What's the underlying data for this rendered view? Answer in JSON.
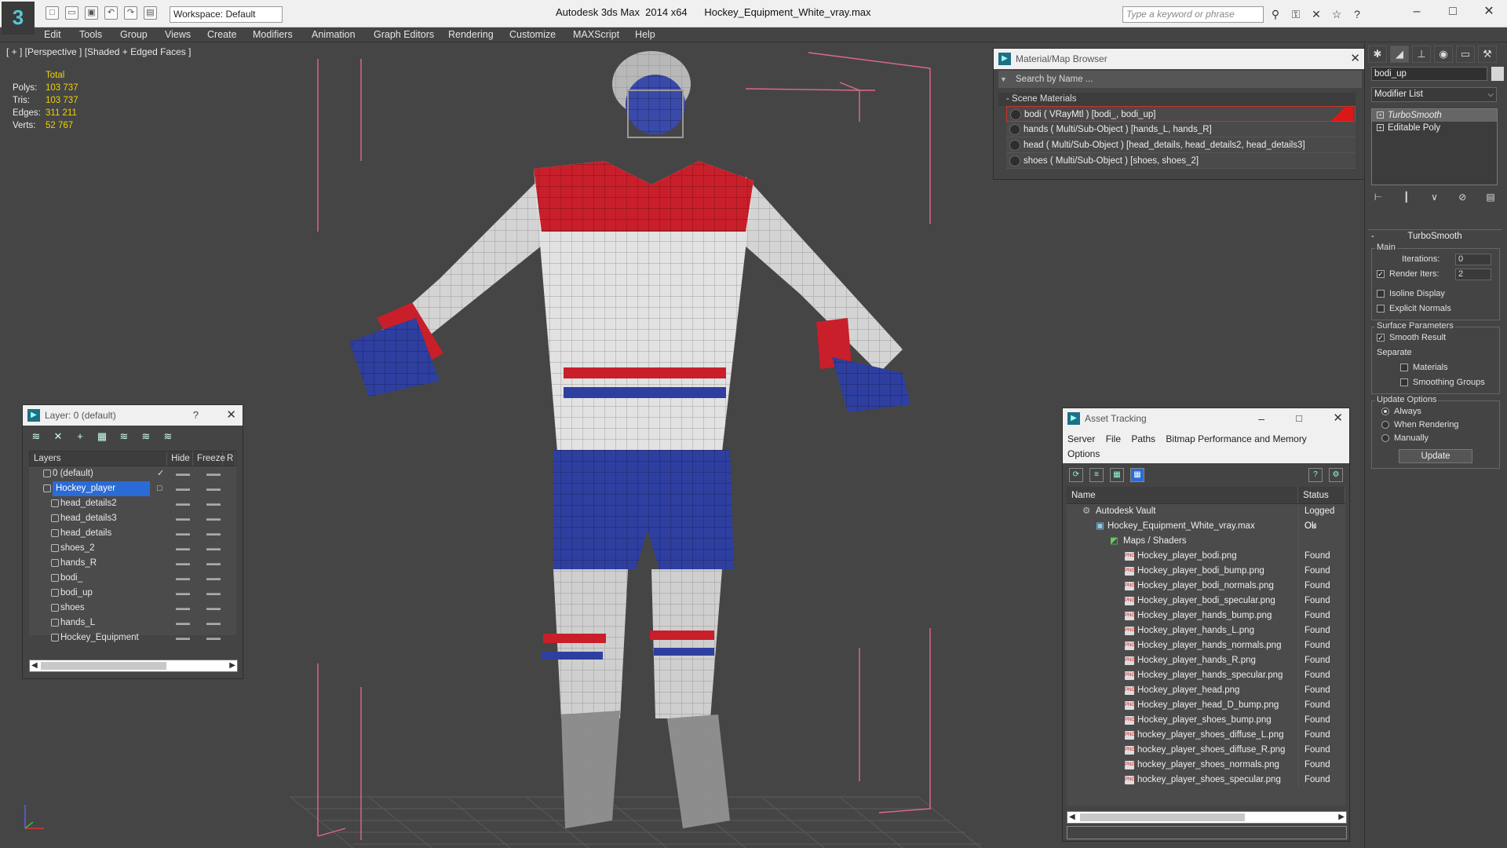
{
  "app": {
    "title": "Autodesk 3ds Max  2014 x64      Hockey_Equipment_White_vray.max",
    "workspace": "Workspace: Default",
    "search_placeholder": "Type a keyword or phrase"
  },
  "menu": [
    "Edit",
    "Tools",
    "Group",
    "Views",
    "Create",
    "Modifiers",
    "Animation",
    "Graph Editors",
    "Rendering",
    "Customize",
    "MAXScript",
    "Help"
  ],
  "viewport": {
    "label": "[ + ] [Perspective ] [Shaded + Edged Faces ]",
    "stats": {
      "header": "Total",
      "rows": [
        {
          "k": "Polys:",
          "v": "103 737"
        },
        {
          "k": "Tris:",
          "v": "103 737"
        },
        {
          "k": "Edges:",
          "v": "311 211"
        },
        {
          "k": "Verts:",
          "v": "52 767"
        }
      ]
    }
  },
  "material_browser": {
    "title": "Material/Map Browser",
    "search": "Search by Name ...",
    "section": "- Scene Materials",
    "items": [
      "bodi  ( VRayMtl ) [bodi_, bodi_up]",
      "hands  ( Multi/Sub-Object ) [hands_L, hands_R]",
      "head  ( Multi/Sub-Object ) [head_details, head_details2, head_details3]",
      "shoes  ( Multi/Sub-Object ) [shoes, shoes_2]"
    ]
  },
  "layers": {
    "title": "Layer: 0 (default)",
    "help": "?",
    "headers": {
      "layers": "Layers",
      "hide": "Hide",
      "freeze": "Freeze",
      "r": "R"
    },
    "default_layer": "0 (default)",
    "parent": "Hockey_player",
    "children": [
      "head_details2",
      "head_details3",
      "head_details",
      "shoes_2",
      "hands_R",
      "bodi_",
      "bodi_up",
      "shoes",
      "hands_L",
      "Hockey_Equipment"
    ]
  },
  "asset_tracking": {
    "title": "Asset Tracking",
    "menu": [
      "Server",
      "File",
      "Paths",
      "Bitmap Performance and Memory"
    ],
    "menu2": "Options",
    "headers": {
      "name": "Name",
      "status": "Status"
    },
    "vault": {
      "name": "Autodesk Vault",
      "status": "Logged Ou"
    },
    "file": {
      "name": "Hockey_Equipment_White_vray.max",
      "status": "Ok"
    },
    "folder": "Maps / Shaders",
    "maps": [
      {
        "name": "Hockey_player_bodi.png",
        "status": "Found"
      },
      {
        "name": "Hockey_player_bodi_bump.png",
        "status": "Found"
      },
      {
        "name": "Hockey_player_bodi_normals.png",
        "status": "Found"
      },
      {
        "name": "Hockey_player_bodi_specular.png",
        "status": "Found"
      },
      {
        "name": "Hockey_player_hands_bump.png",
        "status": "Found"
      },
      {
        "name": "Hockey_player_hands_L.png",
        "status": "Found"
      },
      {
        "name": "Hockey_player_hands_normals.png",
        "status": "Found"
      },
      {
        "name": "Hockey_player_hands_R.png",
        "status": "Found"
      },
      {
        "name": "Hockey_player_hands_specular.png",
        "status": "Found"
      },
      {
        "name": "Hockey_player_head.png",
        "status": "Found"
      },
      {
        "name": "Hockey_player_head_D_bump.png",
        "status": "Found"
      },
      {
        "name": "Hockey_player_shoes_bump.png",
        "status": "Found"
      },
      {
        "name": "hockey_player_shoes_diffuse_L.png",
        "status": "Found"
      },
      {
        "name": "hockey_player_shoes_diffuse_R.png",
        "status": "Found"
      },
      {
        "name": "hockey_player_shoes_normals.png",
        "status": "Found"
      },
      {
        "name": "hockey_player_shoes_specular.png",
        "status": "Found"
      }
    ]
  },
  "command_panel": {
    "object_name": "bodi_up",
    "modifier_list": "Modifier List",
    "stack": [
      "TurboSmooth",
      "Editable Poly"
    ],
    "rollout": "TurboSmooth",
    "main": {
      "label": "Main",
      "iterations_label": "Iterations:",
      "iterations": "0",
      "render_iters_label": "Render Iters:",
      "render_iters": "2",
      "isoline": "Isoline Display",
      "explicit": "Explicit Normals"
    },
    "surface": {
      "label": "Surface Parameters",
      "smooth": "Smooth Result",
      "separate": "Separate",
      "materials": "Materials",
      "smoothing": "Smoothing Groups"
    },
    "update": {
      "label": "Update Options",
      "always": "Always",
      "rendering": "When Rendering",
      "manually": "Manually",
      "button": "Update"
    }
  },
  "colors": {
    "accent": "#2a6bd6",
    "jersey_red": "#c81f2a",
    "jersey_blue": "#2e3fa0",
    "stat_yellow": "#f0d200"
  }
}
